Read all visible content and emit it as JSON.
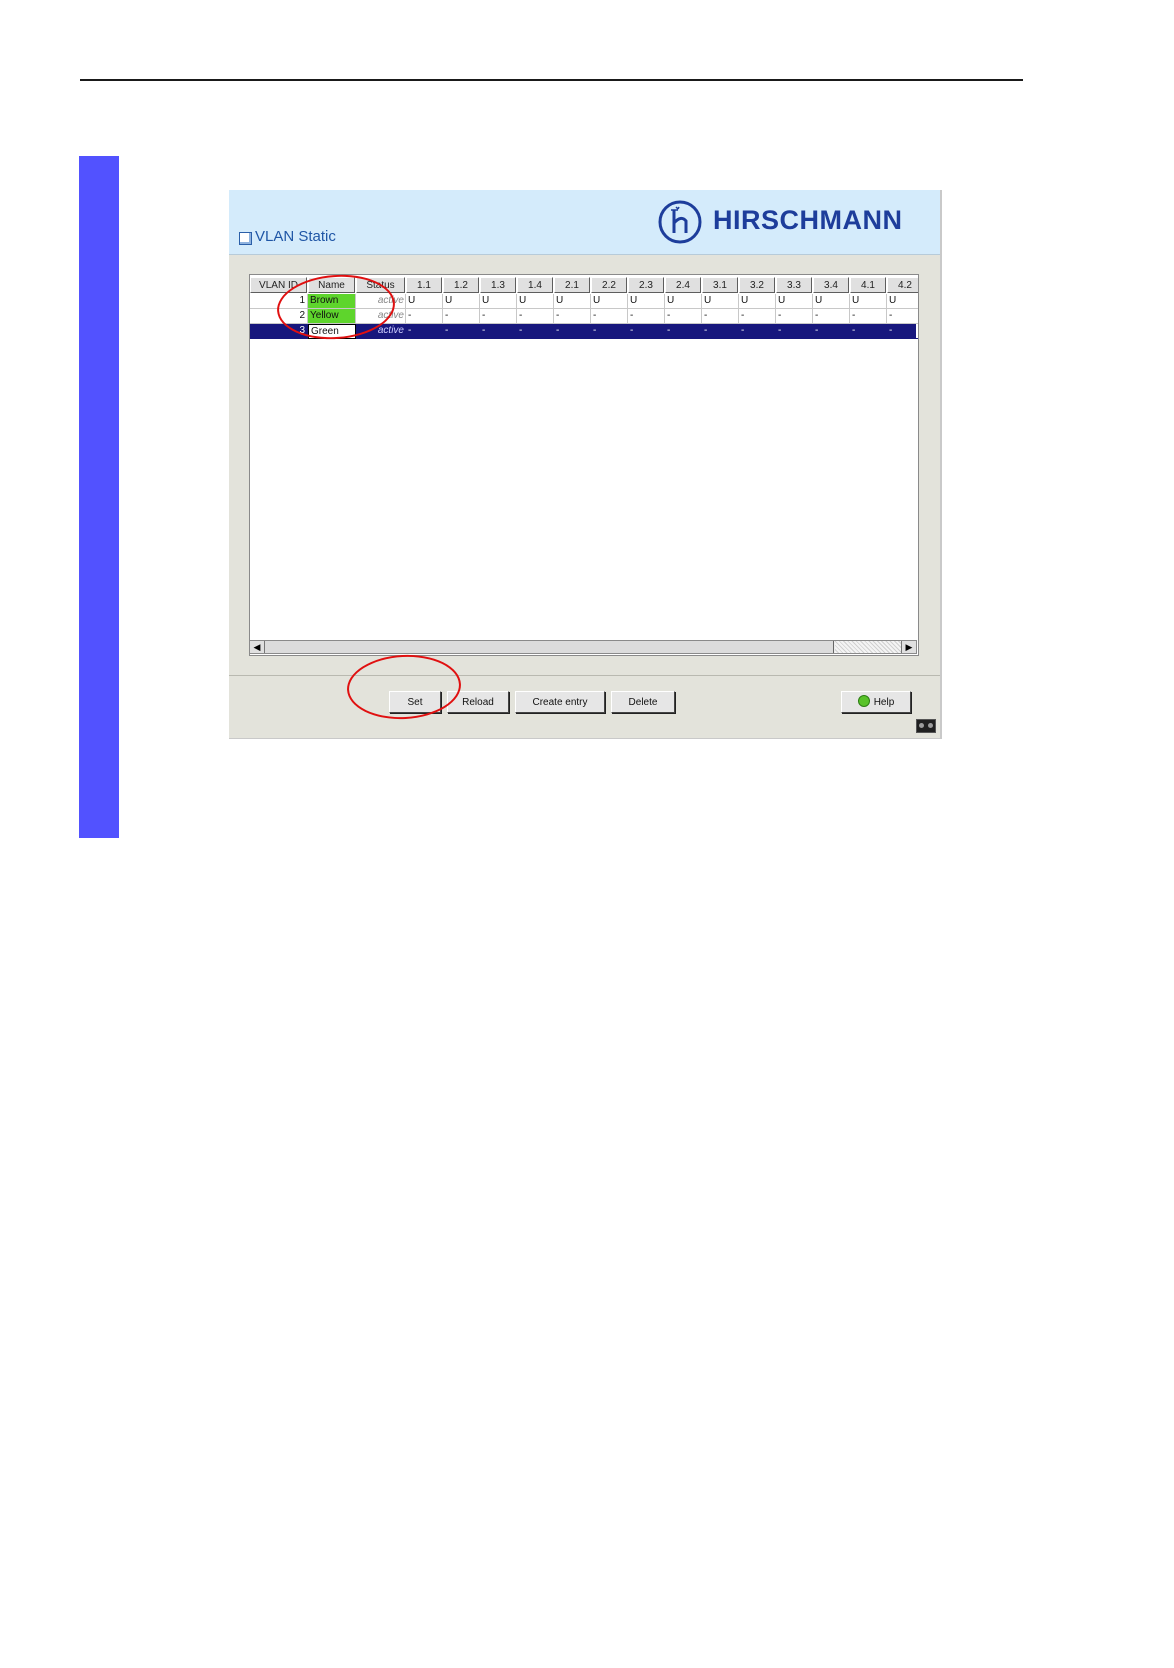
{
  "window": {
    "title": "VLAN Static",
    "brand": "HIRSCHMANN"
  },
  "table": {
    "columns": [
      "VLAN ID",
      "Name",
      "Status",
      "1.1",
      "1.2",
      "1.3",
      "1.4",
      "2.1",
      "2.2",
      "2.3",
      "2.4",
      "3.1",
      "3.2",
      "3.3",
      "3.4",
      "4.1",
      "4.2"
    ],
    "rows": [
      {
        "id": "1",
        "name": "Brown",
        "status": "active",
        "ports": [
          "U",
          "U",
          "U",
          "U",
          "U",
          "U",
          "U",
          "U",
          "U",
          "U",
          "U",
          "U",
          "U",
          "U"
        ],
        "selected": false,
        "name_style": "green"
      },
      {
        "id": "2",
        "name": "Yellow",
        "status": "active",
        "ports": [
          "-",
          "-",
          "-",
          "-",
          "-",
          "-",
          "-",
          "-",
          "-",
          "-",
          "-",
          "-",
          "-",
          "-"
        ],
        "selected": false,
        "name_style": "green"
      },
      {
        "id": "3",
        "name": "Green",
        "status": "active",
        "ports": [
          "-",
          "-",
          "-",
          "-",
          "-",
          "-",
          "-",
          "-",
          "-",
          "-",
          "-",
          "-",
          "-",
          "-"
        ],
        "selected": true,
        "name_style": "edit"
      }
    ]
  },
  "buttons": {
    "set": "Set",
    "reload": "Reload",
    "create_entry": "Create entry",
    "delete": "Delete",
    "help": "Help"
  },
  "colors": {
    "side_bar": "#5252ff",
    "header_bg": "#d4ebfb",
    "brand_blue": "#1d3d9b",
    "selected_row": "#17177d",
    "name_highlight": "#5ed52c",
    "annotation": "#e01010"
  }
}
